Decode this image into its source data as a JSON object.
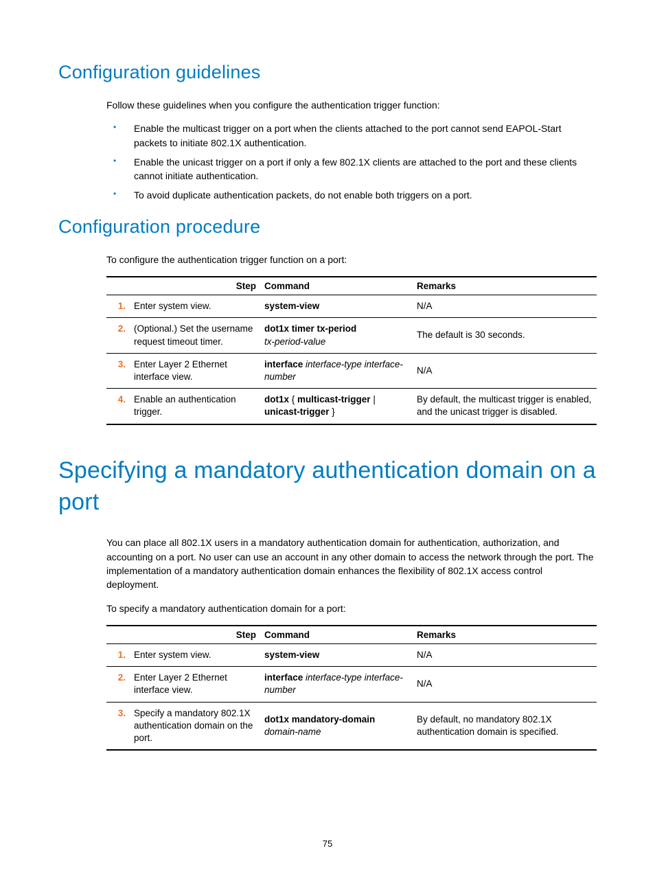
{
  "sections": {
    "guidelines": {
      "heading": "Configuration guidelines",
      "intro": "Follow these guidelines when you configure the authentication trigger function:",
      "bullets": [
        "Enable the multicast trigger on a port when the clients attached to the port cannot send EAPOL-Start packets to initiate 802.1X authentication.",
        "Enable the unicast trigger on a port if only a few 802.1X clients are attached to the port and these clients cannot initiate authentication.",
        "To avoid duplicate authentication packets, do not enable both triggers on a port."
      ]
    },
    "procedure": {
      "heading": "Configuration procedure",
      "intro": "To configure the authentication trigger function on a port:",
      "columns": {
        "step": "Step",
        "command": "Command",
        "remarks": "Remarks"
      },
      "rows": [
        {
          "num": "1.",
          "step": "Enter system view.",
          "cmd_bold": "system-view",
          "cmd_ital": "",
          "remarks": "N/A"
        },
        {
          "num": "2.",
          "step": "(Optional.) Set the username request timeout timer.",
          "cmd_bold": "dot1x timer tx-period",
          "cmd_ital": "tx-period-value",
          "remarks": "The default is 30 seconds."
        },
        {
          "num": "3.",
          "step": "Enter Layer 2 Ethernet interface view.",
          "cmd_bold": "interface",
          "cmd_ital_inline": "interface-type interface-number",
          "remarks": "N/A"
        },
        {
          "num": "4.",
          "step": "Enable an authentication trigger.",
          "cmd_bold1": "dot1x",
          "cmd_brace_open": " { ",
          "cmd_bold2": "multicast-trigger",
          "cmd_pipe": " | ",
          "cmd_bold3": "unicast-trigger",
          "cmd_brace_close": " }",
          "remarks": "By default, the multicast trigger is enabled, and the unicast trigger is disabled."
        }
      ]
    },
    "mandatory": {
      "heading": "Specifying a mandatory authentication domain on a port",
      "para": "You can place all 802.1X users in a mandatory authentication domain for authentication, authorization, and accounting on a port. No user can use an account in any other domain to access the network through the port. The implementation of a mandatory authentication domain enhances the flexibility of 802.1X access control deployment.",
      "intro": "To specify a mandatory authentication domain for a port:",
      "columns": {
        "step": "Step",
        "command": "Command",
        "remarks": "Remarks"
      },
      "rows": [
        {
          "num": "1.",
          "step": "Enter system view.",
          "cmd_bold": "system-view",
          "remarks": "N/A"
        },
        {
          "num": "2.",
          "step": "Enter Layer 2 Ethernet interface view.",
          "cmd_bold": "interface",
          "cmd_ital_inline": "interface-type interface-number",
          "remarks": "N/A"
        },
        {
          "num": "3.",
          "step": "Specify a mandatory 802.1X authentication domain on the port.",
          "cmd_bold": "dot1x mandatory-domain",
          "cmd_ital": "domain-name",
          "remarks": "By default, no mandatory 802.1X authentication domain is specified."
        }
      ]
    }
  },
  "page_number": "75"
}
